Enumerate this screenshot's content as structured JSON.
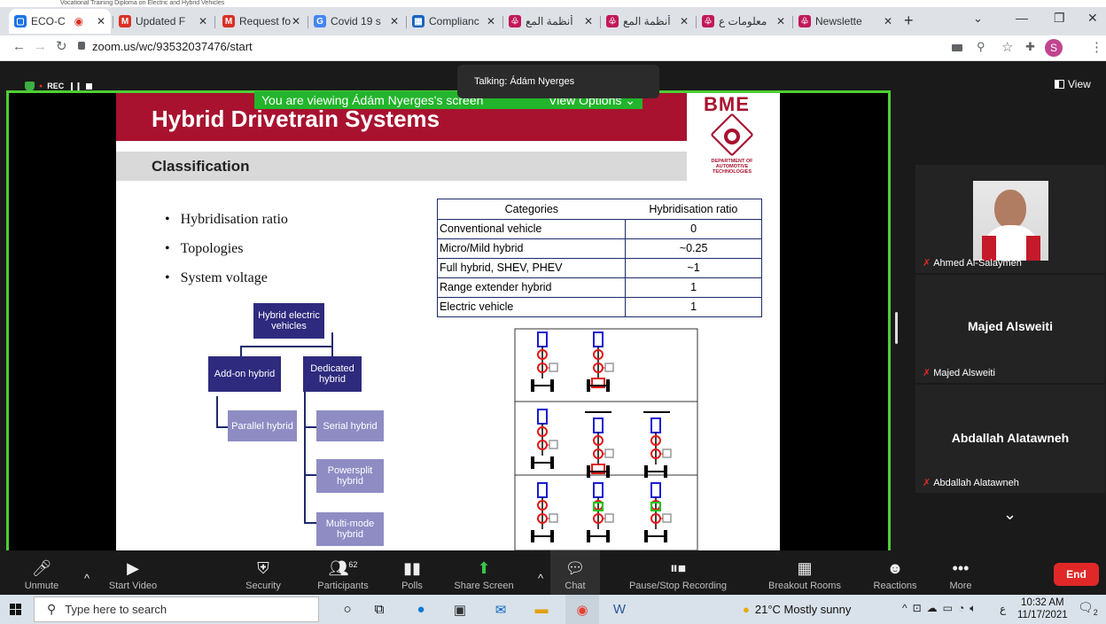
{
  "topstrip": {
    "text": "Vocational Training Diploma on Electric and Hybrid Vehicles"
  },
  "tabs": [
    {
      "title": "ECO-C",
      "color": "#1a73e8",
      "glyph": "▢",
      "active": true
    },
    {
      "title": "Updated F",
      "color": "#d93025",
      "glyph": "M"
    },
    {
      "title": "Request fo",
      "color": "#d93025",
      "glyph": "M"
    },
    {
      "title": "Covid 19 s",
      "color": "#4285f4",
      "glyph": "G"
    },
    {
      "title": "Complianc",
      "color": "#1565c0",
      "glyph": "▦"
    },
    {
      "title": "أنظمة المع",
      "color": "#c2185b",
      "glyph": "♧"
    },
    {
      "title": "أنظمة المع",
      "color": "#c2185b",
      "glyph": "♧"
    },
    {
      "title": "معلومات ع",
      "color": "#c2185b",
      "glyph": "♧"
    },
    {
      "title": "Newslette",
      "color": "#c2185b",
      "glyph": "♧"
    }
  ],
  "browser": {
    "url": "zoom.us/wc/93532037476/start",
    "profile": "S",
    "new_tab": "+"
  },
  "meeting": {
    "rec": "REC",
    "view_label": "View",
    "viewing_text": "You are viewing Ádám Nyerges's screen",
    "view_options": "View Options",
    "talking": "Talking: Ádám Nyerges"
  },
  "slide": {
    "title": "Hybrid Drivetrain Systems",
    "subtitle": "Classification",
    "logo_main": "BME",
    "logo_sub": [
      "DEPARTMENT OF",
      "AUTOMOTIVE",
      "TECHNOLOGIES"
    ],
    "bullets": [
      "Hybridisation ratio",
      "Topologies",
      "System voltage"
    ],
    "table": {
      "headers": [
        "Categories",
        "Hybridisation ratio"
      ],
      "rows": [
        [
          "Conventional vehicle",
          "0"
        ],
        [
          "Micro/Mild hybrid",
          "~0.25"
        ],
        [
          "Full hybrid, SHEV, PHEV",
          "~1"
        ],
        [
          "Range extender hybrid",
          "1"
        ],
        [
          "Electric vehicle",
          "1"
        ]
      ]
    },
    "tree": {
      "root": "Hybrid electric vehicles",
      "addon": "Add-on hybrid",
      "dedicated": "Dedicated hybrid",
      "parallel": "Parallel hybrid",
      "serial": "Serial hybrid",
      "powersplit": "Powersplit hybrid",
      "multimode": "Multi-mode hybrid"
    }
  },
  "participants": [
    {
      "name": "Ahmed Al-Salaymeh",
      "has_video": true
    },
    {
      "name": "Majed Alsweiti",
      "display": "Majed Alsweiti"
    },
    {
      "name": "Abdallah Alatawneh",
      "display": "Abdallah Alatawneh"
    }
  ],
  "toolbar": {
    "unmute": "Unmute",
    "start_video": "Start Video",
    "security": "Security",
    "participants": "Participants",
    "participants_count": "62",
    "polls": "Polls",
    "share_screen": "Share Screen",
    "chat": "Chat",
    "recording": "Pause/Stop Recording",
    "breakout": "Breakout Rooms",
    "reactions": "Reactions",
    "more": "More",
    "end": "End"
  },
  "taskbar": {
    "search_placeholder": "Type here to search",
    "weather": "21°C  Mostly sunny",
    "time": "10:32 AM",
    "date": "11/17/2021",
    "lang": "ع",
    "notif": "2"
  },
  "colors": {
    "zoom_green": "#4fce34",
    "slide_red": "#a8122f",
    "navy": "#2e2a7e",
    "lavender": "#8e8cc3",
    "end_red": "#e02828"
  }
}
